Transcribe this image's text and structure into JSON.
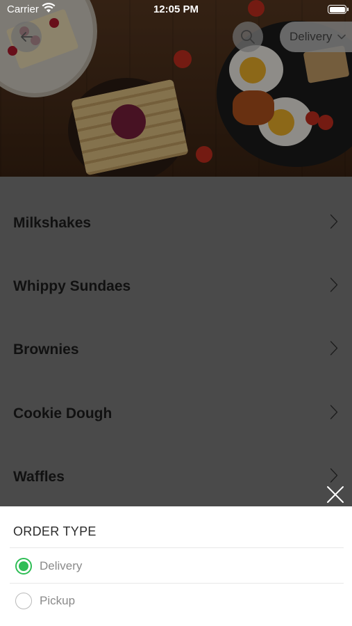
{
  "status_bar": {
    "carrier": "Carrier",
    "time": "12:05 PM"
  },
  "header": {
    "back_icon": "arrow-left-icon",
    "search_icon": "search-icon",
    "order_type_selected": "Delivery",
    "dropdown_icon": "chevron-down-icon"
  },
  "categories": [
    {
      "label": "Milkshakes"
    },
    {
      "label": "Whippy Sundaes"
    },
    {
      "label": "Brownies"
    },
    {
      "label": "Cookie Dough"
    },
    {
      "label": "Waffles"
    }
  ],
  "order_sheet": {
    "title": "ORDER TYPE",
    "close_icon": "close-icon",
    "options": [
      {
        "label": "Delivery",
        "selected": true
      },
      {
        "label": "Pickup",
        "selected": false
      }
    ]
  },
  "colors": {
    "accent_green": "#2ebd55",
    "overlay": "#4a4a4a"
  }
}
